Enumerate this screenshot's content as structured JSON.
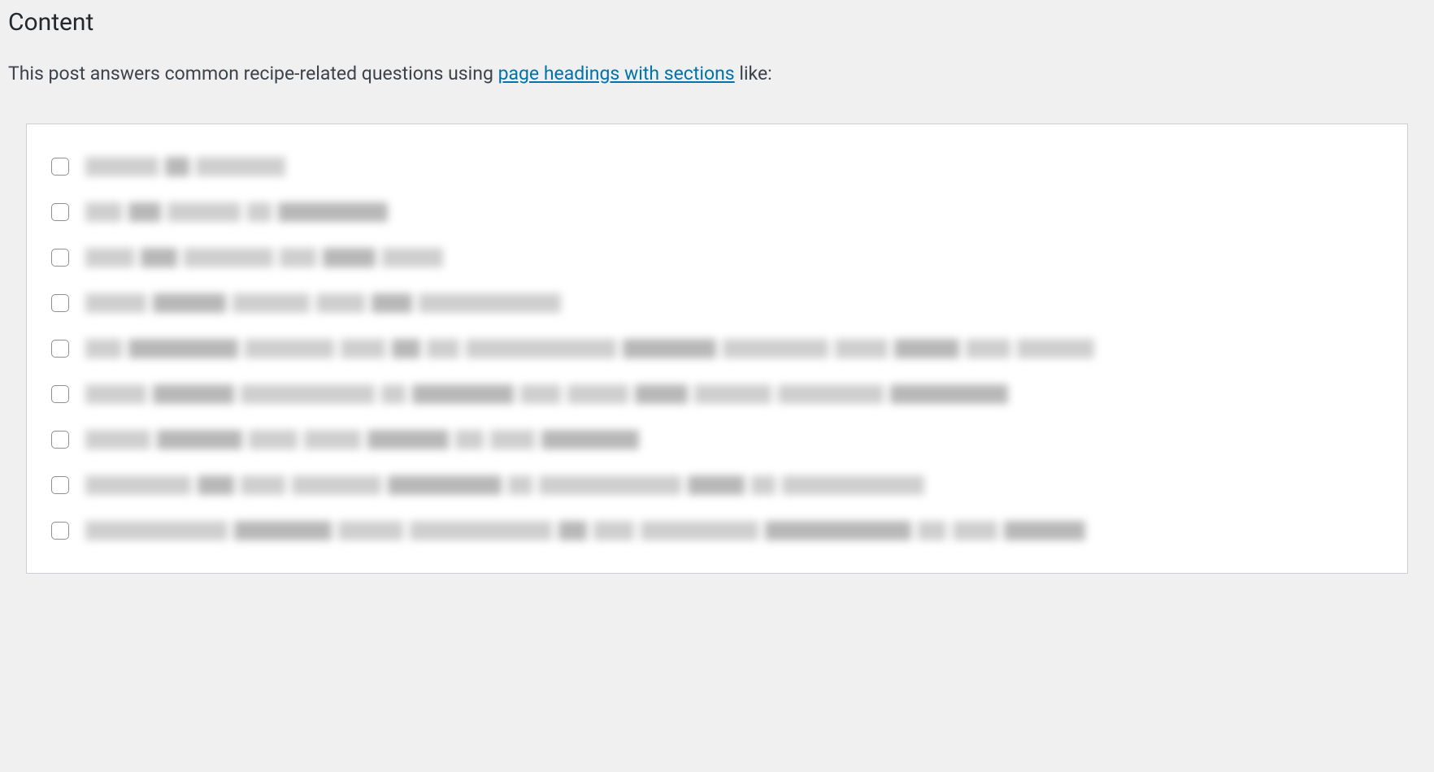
{
  "header": {
    "title": "Content"
  },
  "intro": {
    "prefix": "This post answers common recipe-related questions using ",
    "link_text": "page headings with sections",
    "suffix": " like:"
  },
  "checklist": {
    "items": [
      {
        "widths": [
          90,
          30,
          110
        ]
      },
      {
        "widths": [
          45,
          40,
          90,
          30,
          135
        ]
      },
      {
        "widths": [
          60,
          45,
          110,
          45,
          65,
          75
        ]
      },
      {
        "widths": [
          75,
          90,
          95,
          60,
          50,
          175
        ]
      },
      {
        "widths": [
          45,
          135,
          110,
          55,
          35,
          40,
          185,
          115,
          130,
          65,
          80,
          55,
          95
        ]
      },
      {
        "widths": [
          75,
          100,
          165,
          30,
          125,
          50,
          75,
          65,
          95,
          130,
          145
        ]
      },
      {
        "widths": [
          80,
          105,
          60,
          70,
          100,
          35,
          55,
          120
        ]
      },
      {
        "widths": [
          130,
          45,
          55,
          110,
          140,
          30,
          175,
          70,
          30,
          175
        ]
      },
      {
        "widths": [
          175,
          120,
          80,
          175,
          35,
          50,
          145,
          180,
          35,
          55,
          100
        ]
      }
    ]
  }
}
